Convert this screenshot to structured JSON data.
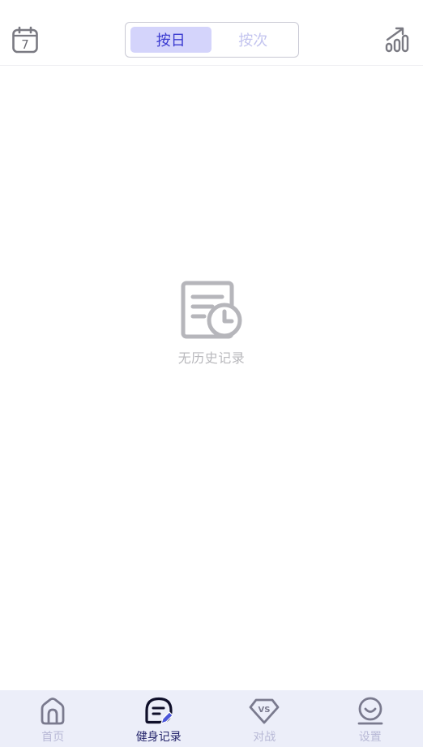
{
  "header": {
    "calendar_day": "7",
    "segments": [
      {
        "label": "按日",
        "active": true
      },
      {
        "label": "按次",
        "active": false
      }
    ]
  },
  "empty_state": {
    "icon": "history-record-icon",
    "text": "无历史记录"
  },
  "tabbar": {
    "items": [
      {
        "label": "首页",
        "icon": "home-icon",
        "active": false
      },
      {
        "label": "健身记录",
        "icon": "fitness-record-icon",
        "active": true
      },
      {
        "label": "对战",
        "icon": "vs-icon",
        "active": false
      },
      {
        "label": "设置",
        "icon": "settings-smile-icon",
        "active": false
      }
    ]
  },
  "colors": {
    "accent": "#3a3ad0",
    "segment_active_bg": "#d4d4fb",
    "tabbar_bg": "#eceef9",
    "muted_text": "#b9b9bd"
  }
}
